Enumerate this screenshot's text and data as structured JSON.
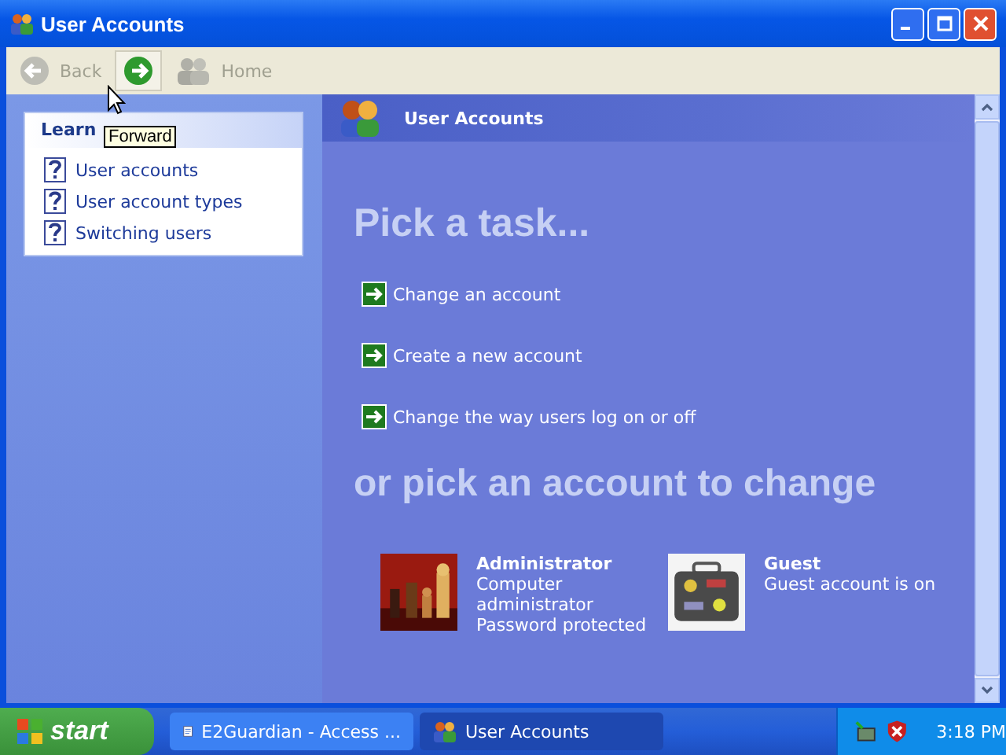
{
  "window": {
    "title": "User Accounts"
  },
  "toolbar": [
    {
      "label": "Back",
      "kind": "back",
      "disabled": true
    },
    {
      "kind": "forward",
      "disabled": false
    },
    {
      "label": "Home",
      "kind": "home",
      "disabled": true
    }
  ],
  "tooltip": "Forward",
  "sidebar": {
    "title": "Learn",
    "items": [
      "User accounts",
      "User account types",
      "Switching users"
    ]
  },
  "header": "User Accounts",
  "heading": "Pick a task...",
  "tasks": [
    "Change an account",
    "Create a new account",
    "Change the way users log on or off"
  ],
  "subheading": "or pick an account to change",
  "accounts": [
    {
      "name": "Administrator",
      "details": [
        "Computer",
        "administrator",
        "Password protected"
      ]
    },
    {
      "name": "Guest",
      "details": [
        "Guest account is on"
      ]
    }
  ],
  "taskbar": {
    "start": "start",
    "tasks": [
      {
        "label": "E2Guardian - Access ...",
        "kind": "document",
        "selected": false
      },
      {
        "label": "User Accounts",
        "kind": "users",
        "selected": true
      }
    ],
    "clock": "3:18 PM"
  }
}
